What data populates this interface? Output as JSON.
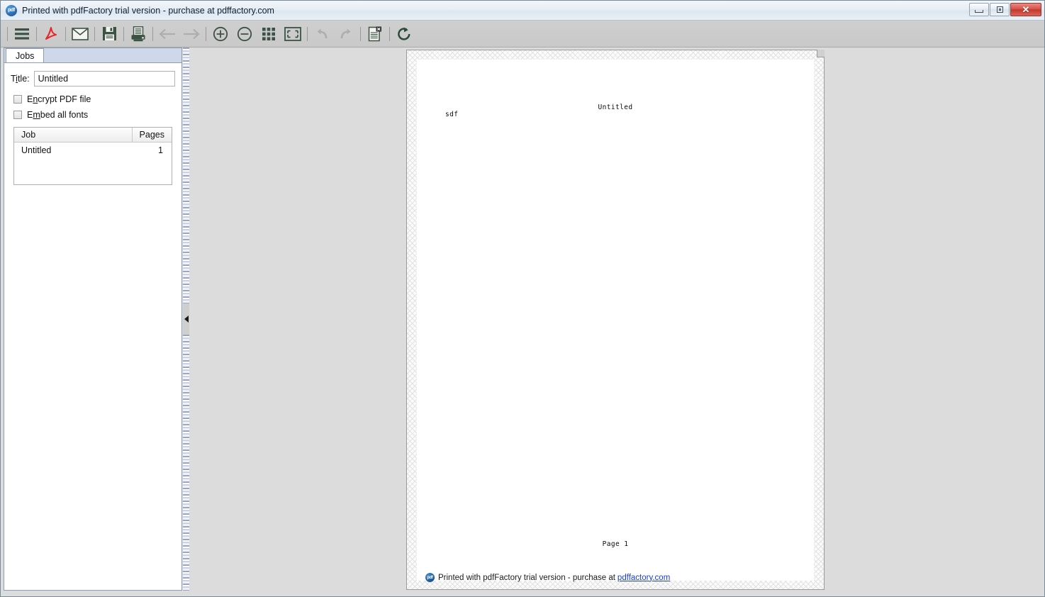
{
  "window": {
    "title": "Printed with pdfFactory trial version - purchase at pdffactory.com",
    "app_icon_text": "pdf",
    "controls": {
      "minimize": "Minimize",
      "maximize": "Maximize",
      "close": "✕"
    }
  },
  "toolbar": {
    "items": [
      {
        "name": "menu-icon",
        "tip": "Menu"
      },
      {
        "name": "pdf-icon",
        "tip": "Save as PDF"
      },
      {
        "name": "email-icon",
        "tip": "Send by email"
      },
      {
        "name": "save-icon",
        "tip": "Save"
      },
      {
        "name": "print-icon",
        "tip": "Print"
      },
      {
        "name": "previous-page-icon",
        "tip": "Previous page"
      },
      {
        "name": "next-page-icon",
        "tip": "Next page"
      },
      {
        "name": "zoom-in-icon",
        "tip": "Zoom in"
      },
      {
        "name": "zoom-out-icon",
        "tip": "Zoom out"
      },
      {
        "name": "thumbnail-grid-icon",
        "tip": "Thumbnails"
      },
      {
        "name": "fit-page-icon",
        "tip": "Fit page"
      },
      {
        "name": "undo-icon",
        "tip": "Undo"
      },
      {
        "name": "redo-icon",
        "tip": "Redo"
      },
      {
        "name": "delete-page-icon",
        "tip": "Delete page"
      },
      {
        "name": "refresh-icon",
        "tip": "Refresh"
      }
    ]
  },
  "left_panel": {
    "tab_label": "Jobs",
    "title_field": {
      "label_prefix": "T",
      "label_accel": "i",
      "label_suffix": "tle:",
      "label_full": "Title:",
      "value": "Untitled",
      "placeholder": ""
    },
    "checkboxes": [
      {
        "label_prefix": "E",
        "accel": "n",
        "label_suffix": "crypt PDF file",
        "label_full": "Encrypt PDF file",
        "checked": false
      },
      {
        "label_prefix": "E",
        "accel": "m",
        "label_suffix": "bed all fonts",
        "label_full": "Embed all fonts",
        "checked": false
      }
    ],
    "job_table": {
      "columns": [
        "Job",
        "Pages"
      ],
      "rows": [
        {
          "job": "Untitled",
          "pages": "1"
        }
      ]
    }
  },
  "splitter": {
    "collapse_direction": "left"
  },
  "document": {
    "title_text": "Untitled",
    "body_text": "sdf",
    "page_number_text": "Page  1",
    "footer": {
      "icon_text": "pdf",
      "text": "Printed with pdfFactory trial version - purchase at",
      "link": "pdffactory.com"
    }
  },
  "colors": {
    "toolbar_icon": "#3b5245",
    "pdf_red": "#e8262a",
    "accent_blue": "#2d6fb5",
    "link_blue": "#1a3fd0",
    "canvas_bg": "#dcdcdc",
    "close_red": "#c0392f"
  }
}
